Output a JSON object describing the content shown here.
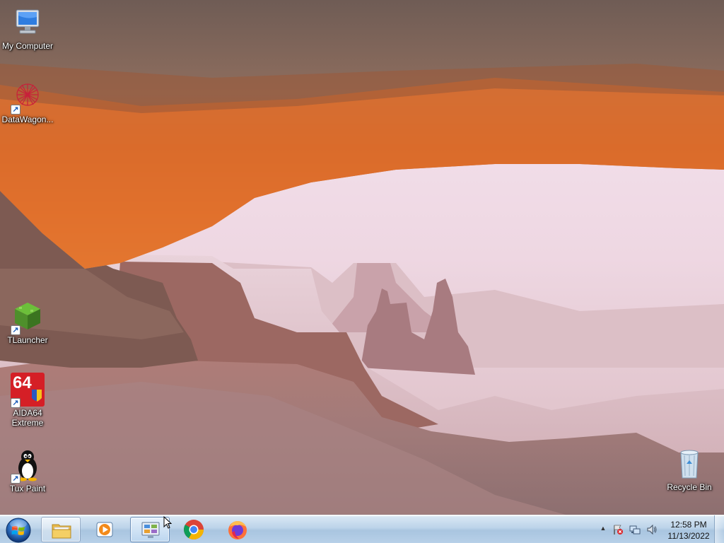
{
  "desktop": {
    "icons": [
      {
        "label": "My Computer",
        "icon": "computer-icon"
      },
      {
        "label": "DataWagon...",
        "icon": "datawagon-icon"
      },
      {
        "label": "TLauncher",
        "icon": "tlauncher-icon"
      },
      {
        "label": "AIDA64\nExtreme",
        "icon": "aida64-icon"
      },
      {
        "label": "Tux Paint",
        "icon": "tux-paint-icon"
      },
      {
        "label": "Recycle Bin",
        "icon": "recycle-bin-icon"
      }
    ],
    "aida_badge": "64"
  },
  "taskbar": {
    "start_icon": "windows-start-icon",
    "items": [
      {
        "name": "file-explorer",
        "icon": "folder-icon",
        "state": "open"
      },
      {
        "name": "media-player",
        "icon": "media-player-icon",
        "state": "pinned"
      },
      {
        "name": "control-panel",
        "icon": "control-panel-icon",
        "state": "active"
      },
      {
        "name": "chrome",
        "icon": "chrome-icon",
        "state": "pinned"
      },
      {
        "name": "firefox",
        "icon": "firefox-icon",
        "state": "pinned"
      }
    ],
    "tray": {
      "show_hidden": "▲",
      "icons": [
        "action-center-flag-icon",
        "network-icon",
        "volume-icon"
      ],
      "time": "12:58 PM",
      "date": "11/13/2022"
    }
  },
  "colors": {
    "taskbar_top": "#dbe9f5",
    "taskbar_bottom": "#a9c5e0",
    "arch_orange": "#e0682a",
    "sky": "#f2e4ee"
  }
}
